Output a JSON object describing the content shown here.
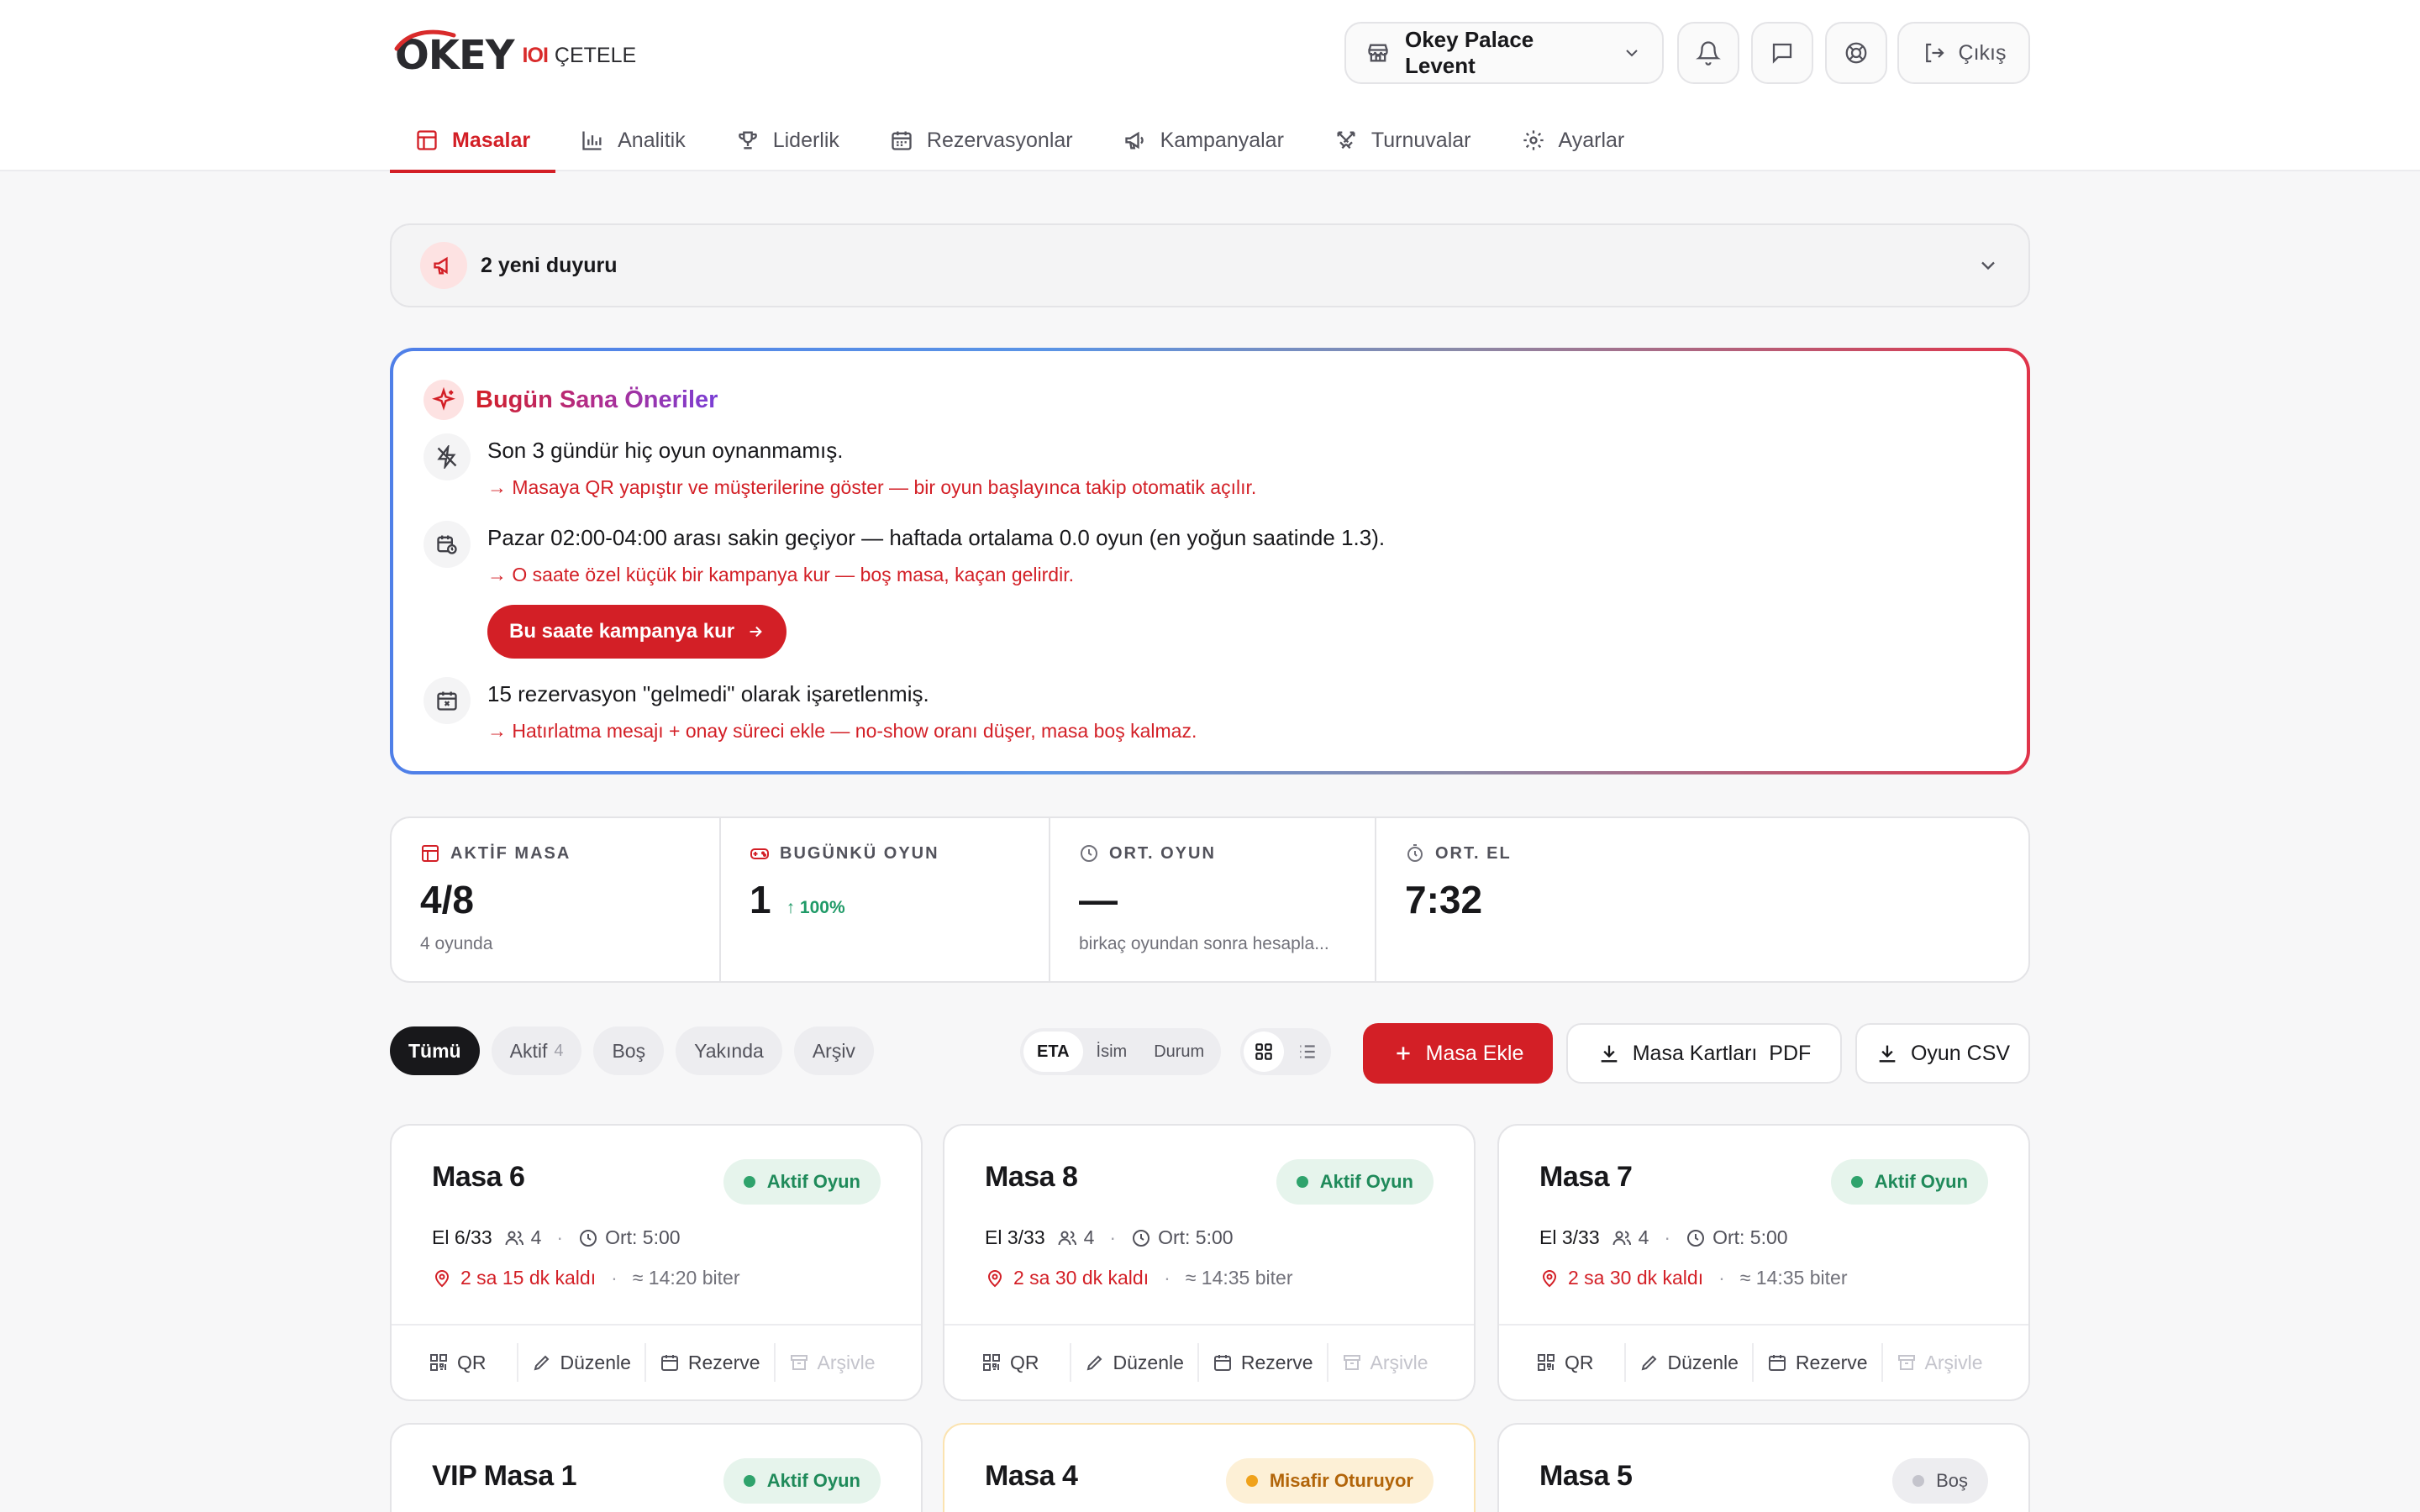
{
  "brand": {
    "logo_text": "OKEY",
    "sub_mark": "IOI",
    "sub_text": "ÇETELE",
    "accent": "#d31f26"
  },
  "header": {
    "venue": "Okey Palace Levent",
    "logout": "Çıkış"
  },
  "nav": [
    {
      "label": "Masalar",
      "icon": "table-icon",
      "active": true
    },
    {
      "label": "Analitik",
      "icon": "bar-chart-icon"
    },
    {
      "label": "Liderlik",
      "icon": "trophy-icon"
    },
    {
      "label": "Rezervasyonlar",
      "icon": "calendar-icon"
    },
    {
      "label": "Kampanyalar",
      "icon": "megaphone-icon"
    },
    {
      "label": "Turnuvalar",
      "icon": "swords-icon"
    },
    {
      "label": "Ayarlar",
      "icon": "gear-icon"
    }
  ],
  "announcement": {
    "text": "2 yeni duyuru"
  },
  "suggestions": {
    "title": "Bugün Sana Öneriler",
    "items": [
      {
        "text": "Son 3 gündür hiç oyun oynanmamış.",
        "hint": "→ Masaya QR yapıştır ve müşterilerine göster — bir oyun başlayınca takip otomatik açılır."
      },
      {
        "text": "Pazar 02:00-04:00 arası sakin geçiyor — haftada ortalama 0.0 oyun (en yoğun saatinde 1.3).",
        "hint": "→ O saate özel küçük bir kampanya kur — boş masa, kaçan gelirdir.",
        "cta": "Bu saate kampanya kur"
      },
      {
        "text": "15 rezervasyon \"gelmedi\" olarak işaretlenmiş.",
        "hint": "→ Hatırlatma mesajı + onay süreci ekle — no-show oranı düşer, masa boş kalmaz."
      }
    ]
  },
  "stats": [
    {
      "label": "AKTİF MASA",
      "value": "4/8",
      "sub": "4 oyunda"
    },
    {
      "label": "BUGÜNKÜ OYUN",
      "value": "1",
      "delta": "↑ 100%"
    },
    {
      "label": "ORT. OYUN",
      "value": "—",
      "sub": "birkaç oyundan sonra hesapla..."
    },
    {
      "label": "ORT. EL",
      "value": "7:32"
    }
  ],
  "filters": {
    "chips": [
      {
        "label": "Tümü",
        "active": true
      },
      {
        "label": "Aktif",
        "count": "4"
      },
      {
        "label": "Boş"
      },
      {
        "label": "Yakında"
      },
      {
        "label": "Arşiv"
      }
    ],
    "sorts": [
      "ETA",
      "İsim",
      "Durum"
    ]
  },
  "buttons": {
    "add": "Masa Ekle",
    "cards_pdf": "Masa Kartları  PDF",
    "csv": "Oyun CSV"
  },
  "card_actions": {
    "qr": "QR",
    "edit": "Düzenle",
    "reserve": "Rezerve",
    "archive": "Arşivle"
  },
  "tables": [
    {
      "name": "Masa 6",
      "status": "Aktif Oyun",
      "hand": "El 6/33",
      "players": "4",
      "avg": "Ort: 5:00",
      "remaining": "2 sa 15 dk kaldı",
      "ends": "≈ 14:20 biter"
    },
    {
      "name": "Masa 8",
      "status": "Aktif Oyun",
      "hand": "El 3/33",
      "players": "4",
      "avg": "Ort: 5:00",
      "remaining": "2 sa 30 dk kaldı",
      "ends": "≈ 14:35 biter"
    },
    {
      "name": "Masa 7",
      "status": "Aktif Oyun",
      "hand": "El 3/33",
      "players": "4",
      "avg": "Ort: 5:00",
      "remaining": "2 sa 30 dk kaldı",
      "ends": "≈ 14:35 biter"
    },
    {
      "name": "VIP Masa 1",
      "status": "Aktif Oyun"
    },
    {
      "name": "Masa 4",
      "status": "Misafir Oturuyor"
    },
    {
      "name": "Masa 5",
      "status": "Boş"
    }
  ]
}
